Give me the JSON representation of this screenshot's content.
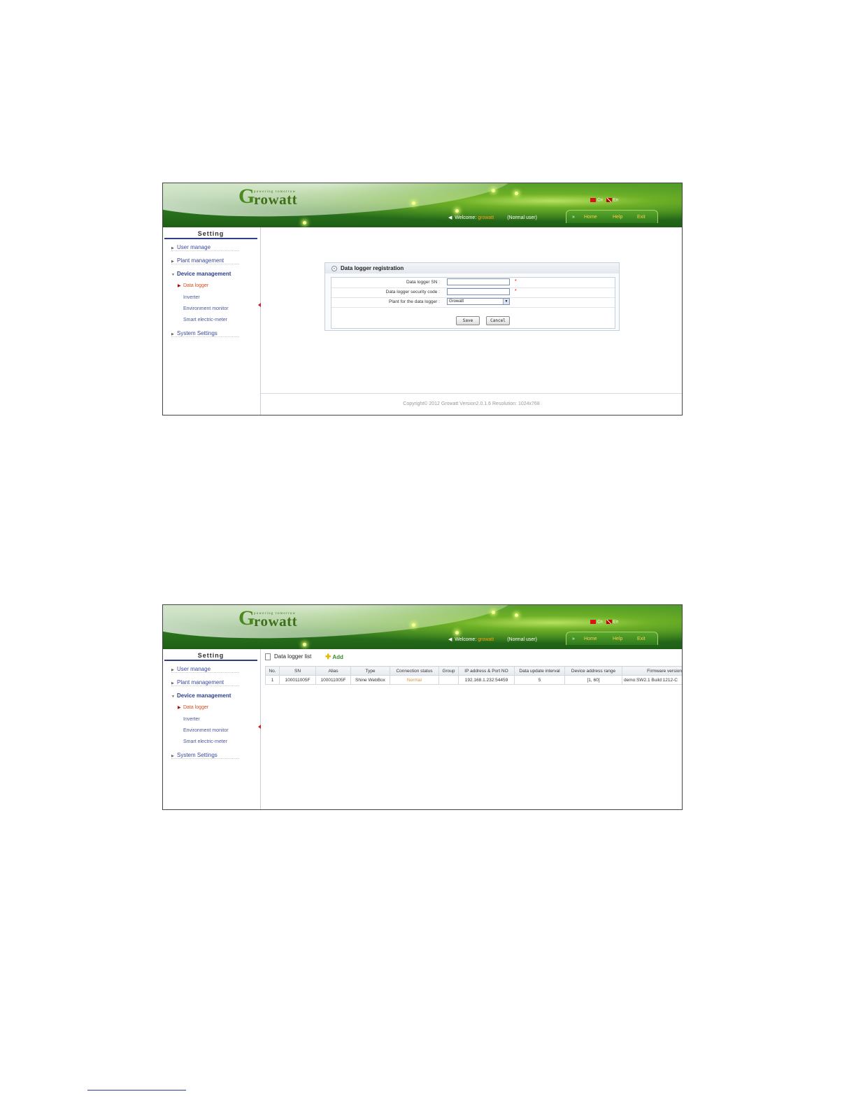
{
  "brand": {
    "tagline": "powering tomorrow",
    "logo_g": "G",
    "logo_rest": "rowatt"
  },
  "header": {
    "lang_cn": "Cn",
    "lang_en": "En",
    "welcome_label": "Welcome:",
    "username": "growatt",
    "user_role": "(Normal user)",
    "nav_prefix": "»",
    "nav_home": "Home",
    "nav_help": "Help",
    "nav_exit": "Exit"
  },
  "sidebar": {
    "title": "Setting",
    "items": {
      "user_manage": "User manage",
      "plant_management": "Plant management",
      "device_management": "Device management",
      "system_settings": "System Settings"
    },
    "sub_items": {
      "data_logger": "Data logger",
      "inverter": "Inverter",
      "environment_monitor": "Environment monitor",
      "smart_meter": "Smart electric-meter"
    }
  },
  "registration": {
    "title": "Data logger registration",
    "sn_label": "Data logger SN :",
    "code_label": "Data logger security code :",
    "plant_label": "Plant for the data logger :",
    "plant_value": "Growatt",
    "required_mark": "*",
    "save_label": "Save",
    "cancel_label": "Cancel"
  },
  "footer": {
    "text": "Copyright©  2012 Growatt  Version2.0.1.6  Resolution: 1024x768"
  },
  "logger_list": {
    "title": "Data logger list",
    "add_label": "Add",
    "columns": [
      "No.",
      "SN",
      "Alias",
      "Type",
      "Connection status",
      "Group",
      "IP address & Port NO",
      "Data update interval",
      "Device address range",
      "Firmware version"
    ],
    "rows": [
      [
        "1",
        "100011005F",
        "100011005F",
        "Shine WebBox",
        "Normal",
        "",
        "192.168.1.232:54459",
        "5",
        "[1, 60]",
        "demo:SW2.1 Build:1212-C"
      ]
    ]
  },
  "colors": {
    "brand_green": "#3f8a1f",
    "menu_blue": "#2b3f8a",
    "active_orange": "#d24b1a",
    "status_orange": "#d79030"
  }
}
